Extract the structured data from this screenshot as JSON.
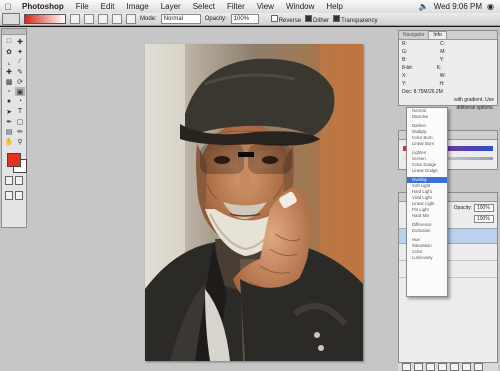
{
  "menubar": {
    "apple": "",
    "items": [
      "Photoshop",
      "File",
      "Edit",
      "Image",
      "Layer",
      "Select",
      "Filter",
      "View",
      "Window",
      "Help"
    ],
    "clock": "Wed 9:06 PM"
  },
  "options": {
    "mode_label": "Mode:",
    "mode_value": "Normal",
    "opacity_label": "Opacity:",
    "opacity_value": "100%",
    "reverse_label": "Reverse",
    "dither_label": "Dither",
    "transparency_label": "Transparency"
  },
  "info_panel": {
    "tabs": [
      "Navigator",
      "Info"
    ],
    "r": "R:",
    "g": "G:",
    "b": "B:",
    "c": "C:",
    "m": "M:",
    "y": "Y:",
    "k": "K:",
    "bits": "8-bit",
    "x": "X:",
    "y_coord": "Y:",
    "w": "W:",
    "h": "H:",
    "doc": "Doc: 8.75M/26.2M",
    "hint1": "with gradient. Use",
    "hint2": "dditional options."
  },
  "layers_panel": {
    "opacity_label": "Opacity:",
    "opacity_value": "100%",
    "fill_value": "100%"
  },
  "blend_modes": {
    "group1": [
      "Normal",
      "Dissolve"
    ],
    "group2": [
      "Darken",
      "Multiply",
      "Color Burn",
      "Linear Burn"
    ],
    "group3": [
      "Lighten",
      "Screen",
      "Color Dodge",
      "Linear Dodge"
    ],
    "group4": [
      "Overlay",
      "Soft Light",
      "Hard Light",
      "Vivid Light",
      "Linear Light",
      "Pin Light",
      "Hard Mix"
    ],
    "group5": [
      "Difference",
      "Exclusion"
    ],
    "group6": [
      "Hue",
      "Saturation",
      "Color",
      "Luminosity"
    ],
    "selected": "Overlay"
  },
  "colors": {
    "foreground": "#e7321e",
    "background": "#ffffff",
    "selection": "#3a72d6"
  }
}
